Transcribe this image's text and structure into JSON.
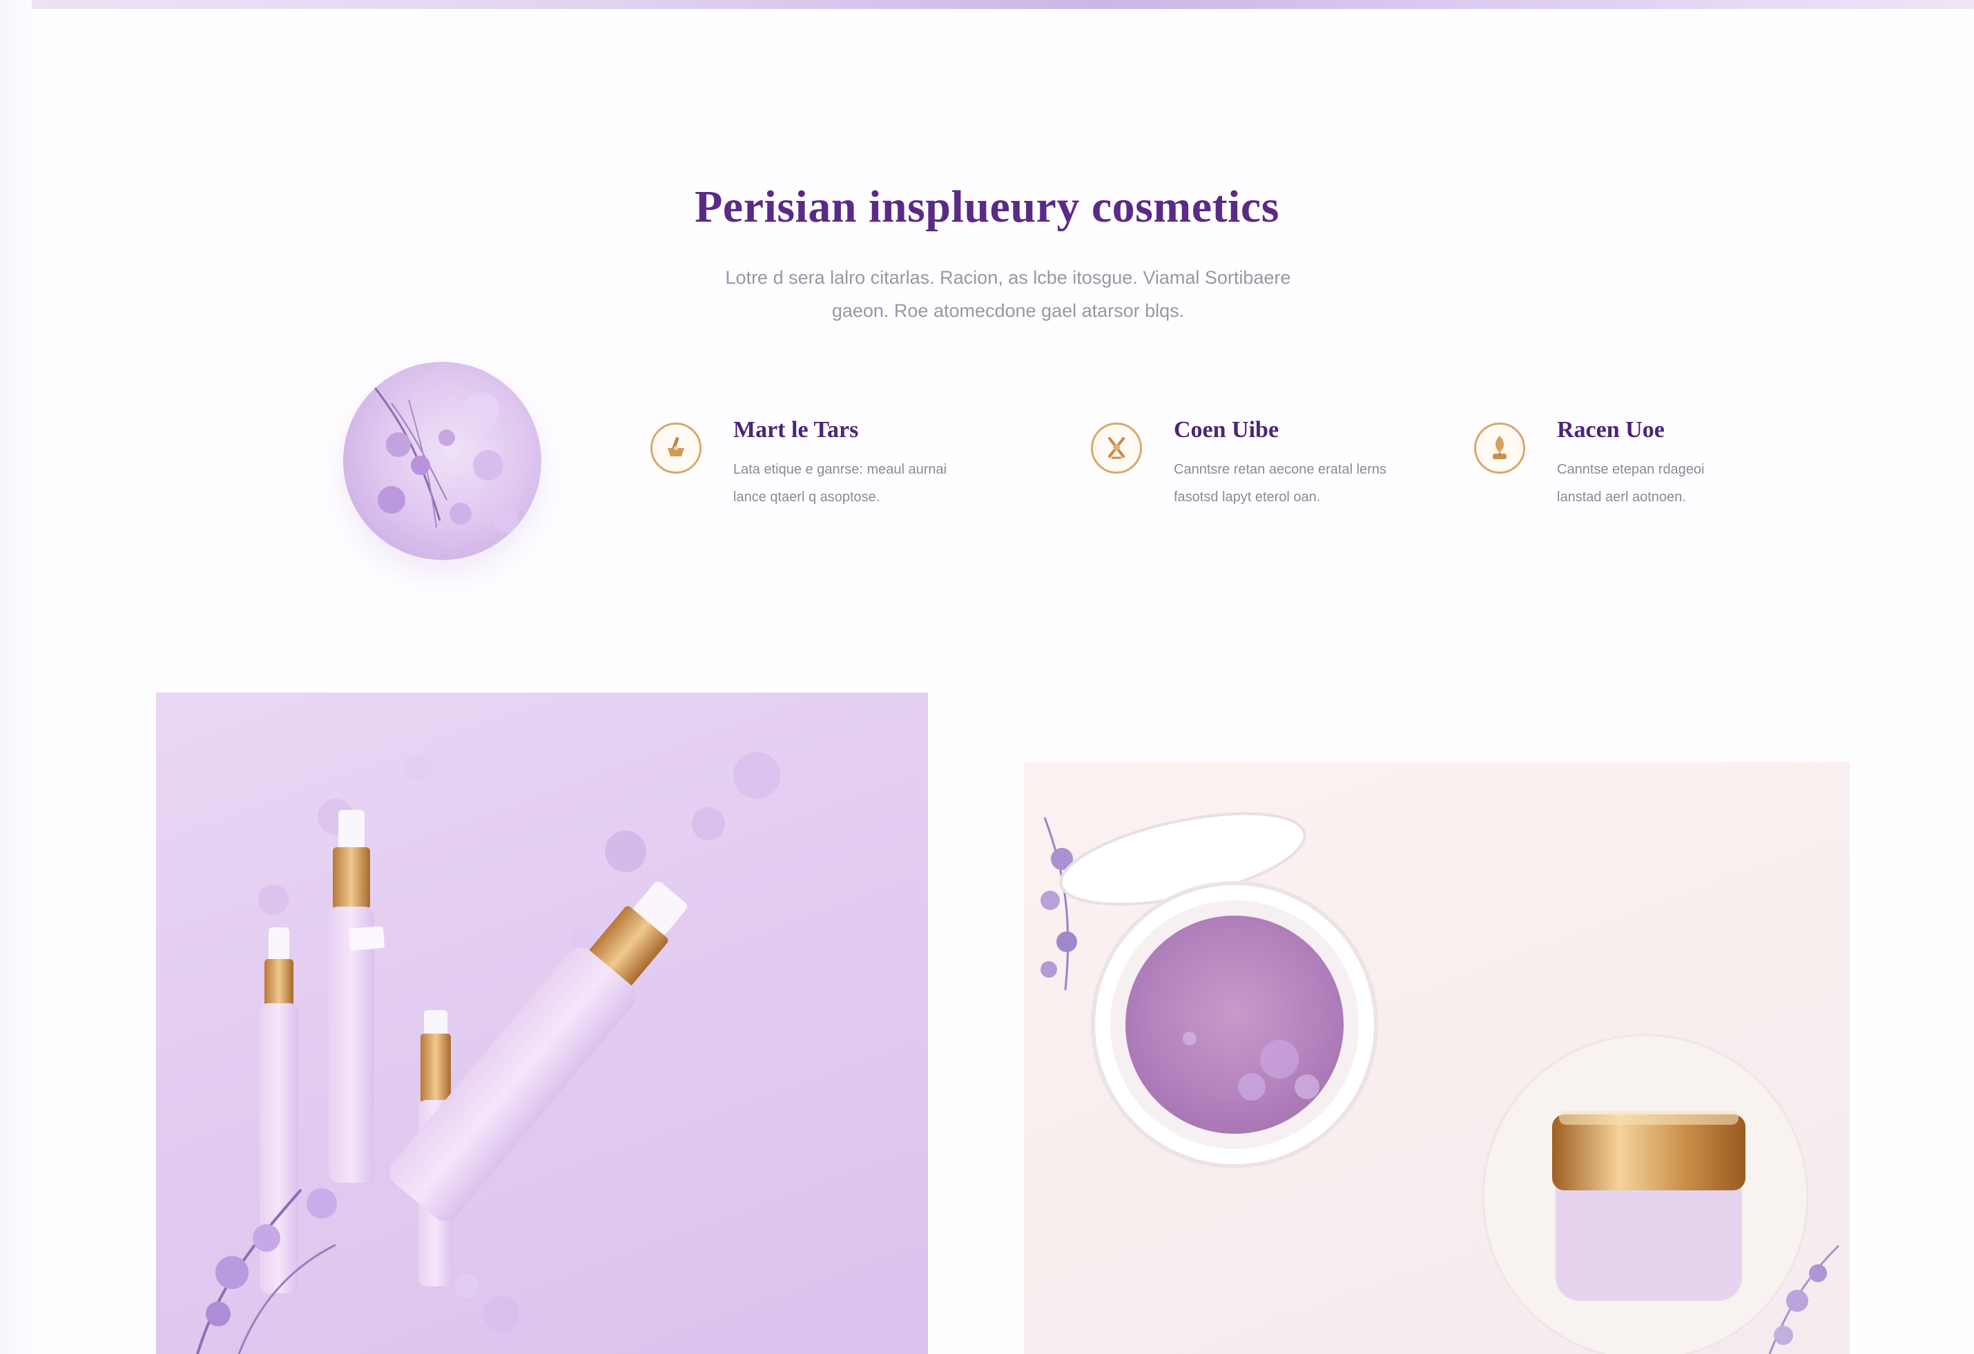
{
  "hero": {
    "title": "Perisian insplueury cosmetics",
    "subtitle_line1": "Lotre d sera lalro citarlas. Racion, as lcbe itosgue. Viamal Sortibaere",
    "subtitle_line2": "gaeon. Roe atomecdone gael atarsor blqs."
  },
  "features": [
    {
      "icon": "mortar-icon",
      "title": "Mart le Tars",
      "text_line1": "Lata etique e ganrse: meaul aurnai",
      "text_line2": "lance qtaerl q asoptose."
    },
    {
      "icon": "flower-icon",
      "title": "Coen Uibe",
      "text_line1": "Canntsre retan aecone eratal lerns",
      "text_line2": "fasotsd lapyt eterol oan."
    },
    {
      "icon": "leaf-icon",
      "title": "Racen Uoe",
      "text_line1": "Canntse etepan rdageoi",
      "text_line2": "lanstad aerl aotnoen."
    }
  ],
  "colors": {
    "accent_purple": "#5b2a86",
    "gold": "#d9a86a",
    "lavender": "#e3cdf1"
  }
}
